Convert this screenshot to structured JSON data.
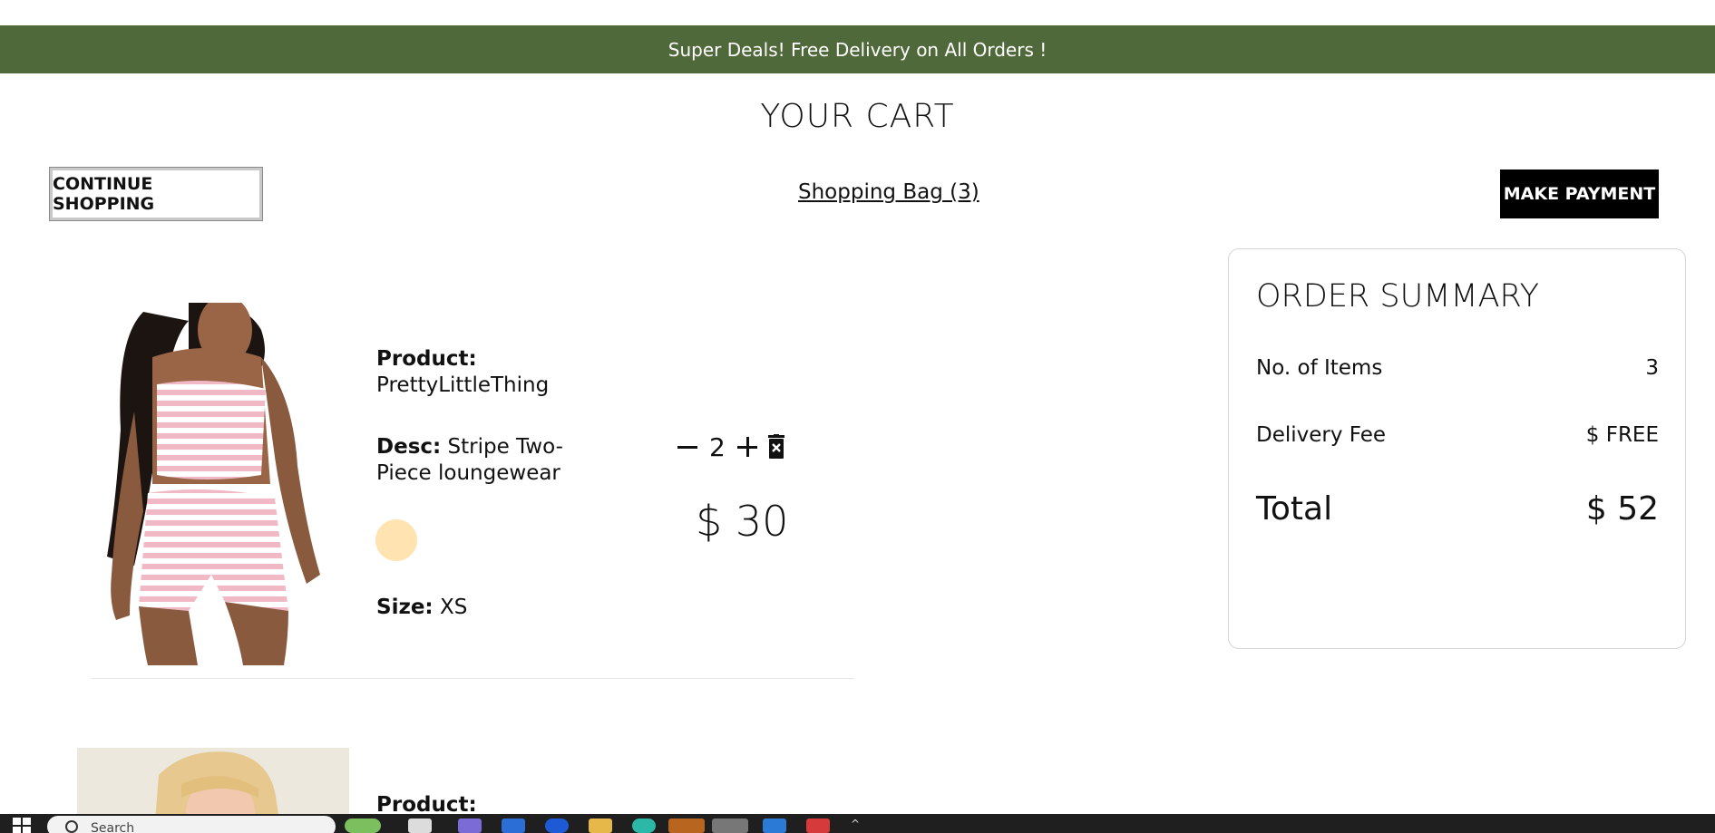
{
  "announcement": "Super Deals! Free Delivery on All Orders !",
  "page_title": "YOUR CART",
  "actions": {
    "continue_label": "CONTINUE SHOPPING",
    "bag_label": "Shopping Bag (3)",
    "payment_label": "MAKE PAYMENT"
  },
  "cart": {
    "products": [
      {
        "product_label": "Product:",
        "product_name": "PrettyLittleThing",
        "desc_label": "Desc:",
        "desc_text": "Stripe Two-Piece loungewear",
        "color": "#ffe3b0",
        "size_label": "Size:",
        "size_value": "XS",
        "quantity": "2",
        "price": "$ 30"
      },
      {
        "product_label": "Product:"
      }
    ]
  },
  "summary": {
    "title": "ORDER SUMMARY",
    "items_label": "No. of Items",
    "items_value": "3",
    "delivery_label": "Delivery Fee",
    "delivery_value": "$ FREE",
    "total_label": "Total",
    "total_value": "$ 52"
  },
  "taskbar": {
    "search_placeholder": "Search"
  },
  "colors": {
    "banner": "#50693a",
    "accent_button": "#000000",
    "swatch": "#ffe3b0"
  }
}
